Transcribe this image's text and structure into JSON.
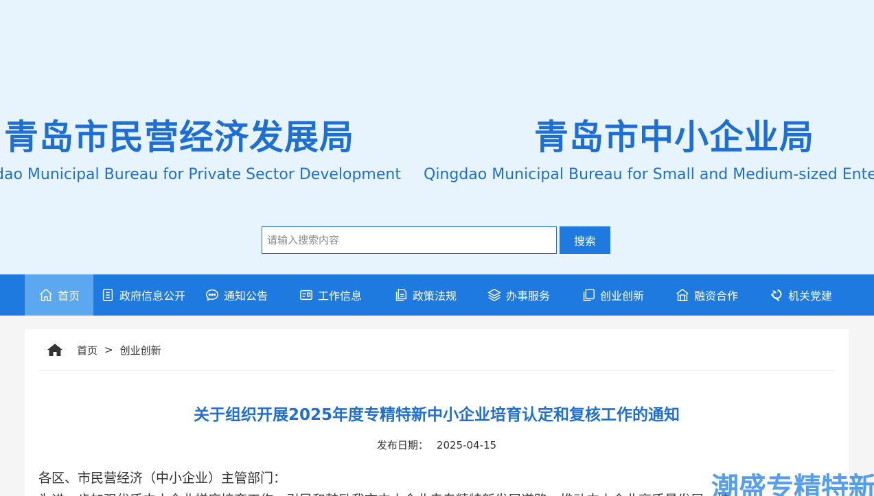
{
  "header": {
    "org1_cn": "青岛市民营经济发展局",
    "org1_en": "dao Municipal Bureau for Private Sector Development",
    "org2_cn": "青岛市中小企业局",
    "org2_en": "Qingdao Municipal Bureau for Small and Medium-sized Enterp"
  },
  "search": {
    "placeholder": "请输入搜索内容",
    "button_label": "搜索"
  },
  "nav": {
    "items": [
      {
        "label": "首页",
        "icon": "home-icon"
      },
      {
        "label": "政府信息公开",
        "icon": "document-list-icon"
      },
      {
        "label": "通知公告",
        "icon": "chat-bubble-icon"
      },
      {
        "label": "工作信息",
        "icon": "id-card-icon"
      },
      {
        "label": "政策法规",
        "icon": "files-icon"
      },
      {
        "label": "办事服务",
        "icon": "layers-icon"
      },
      {
        "label": "创业创新",
        "icon": "copy-icon"
      },
      {
        "label": "融资合作",
        "icon": "building-icon"
      },
      {
        "label": "机关党建",
        "icon": "party-emblem-icon"
      }
    ]
  },
  "breadcrumb": {
    "home": "首页",
    "separator": ">",
    "current": "创业创新"
  },
  "article": {
    "title": "关于组织开展2025年度专精特新中小企业培育认定和复核工作的通知",
    "publish_label": "发布日期：",
    "publish_date": "2025-04-15",
    "salutation": "各区、市民营经济（中小企业）主管部门：",
    "first_line": "为进一步加强优质中小企业梯度培育工作，引导和鼓励我市中小企业走专精特新发展道路，推动中小企业高质量发展，按"
  },
  "watermark": "潮盛专精特新",
  "colors": {
    "brand_blue": "#1f6fd3",
    "nav_blue": "#1f7ae0",
    "nav_active": "#5ba8f0",
    "banner_bg": "#e8f4fd"
  }
}
